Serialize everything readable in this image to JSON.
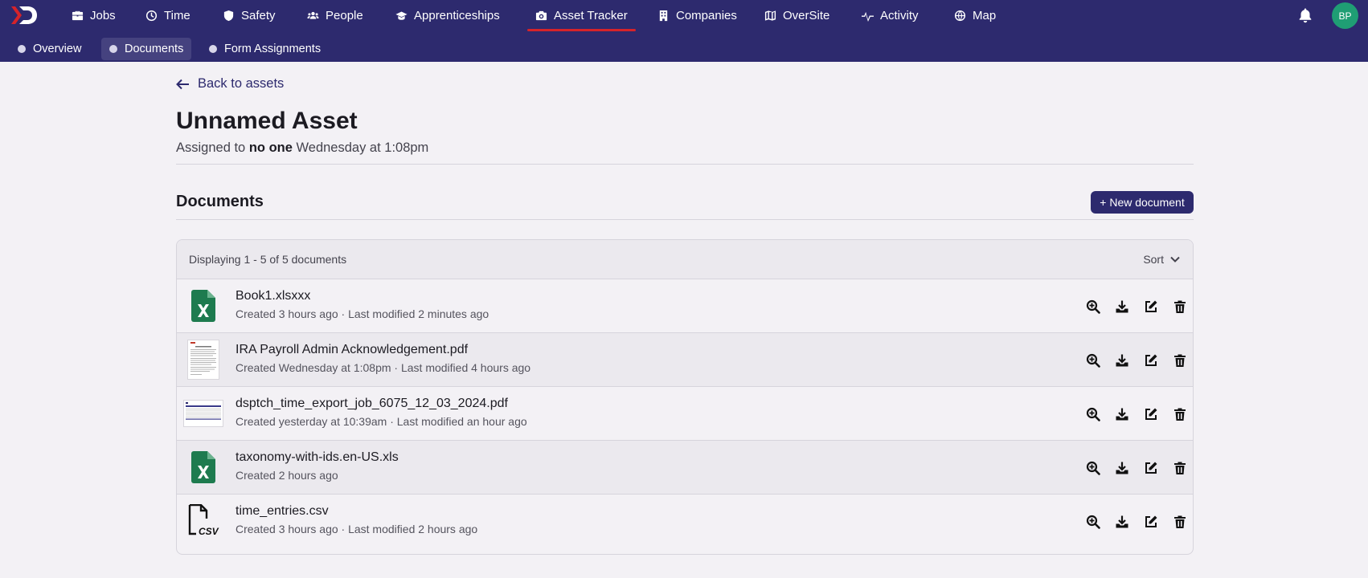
{
  "nav": {
    "items": [
      {
        "label": "Jobs",
        "icon": "briefcase-icon"
      },
      {
        "label": "Time",
        "icon": "clock-icon"
      },
      {
        "label": "Safety",
        "icon": "shield-icon"
      },
      {
        "label": "People",
        "icon": "people-icon"
      },
      {
        "label": "Apprenticeships",
        "icon": "graduation-cap-icon"
      },
      {
        "label": "Asset Tracker",
        "icon": "camera-icon",
        "active": true
      },
      {
        "label": "Companies",
        "icon": "building-icon"
      },
      {
        "label": "OverSite",
        "icon": "map-fold-icon"
      },
      {
        "label": "Activity",
        "icon": "pulse-icon"
      },
      {
        "label": "Map",
        "icon": "globe-icon"
      }
    ],
    "avatar_initials": "BP",
    "accent": "#d6232a",
    "bar_color": "#2d2a6e"
  },
  "subnav": {
    "items": [
      {
        "label": "Overview"
      },
      {
        "label": "Documents",
        "active": true
      },
      {
        "label": "Form Assignments"
      }
    ]
  },
  "page": {
    "back_label": "Back to assets",
    "title": "Unnamed Asset",
    "assigned_prefix": "Assigned to",
    "assigned_to": "no one",
    "assigned_when": "Wednesday at 1:08pm"
  },
  "documents": {
    "heading": "Documents",
    "new_button": "+ New document",
    "count_text": "Displaying 1 - 5 of 5 documents",
    "sort_label": "Sort",
    "rows": [
      {
        "name": "Book1.xlsxxx",
        "meta": "Created 3 hours ago · Last modified 2 minutes ago",
        "type": "excel"
      },
      {
        "name": "IRA Payroll Admin Acknowledgement.pdf",
        "meta": "Created Wednesday at 1:08pm · Last modified 4 hours ago",
        "type": "pdf-page"
      },
      {
        "name": "dsptch_time_export_job_6075_12_03_2024.pdf",
        "meta": "Created yesterday at 10:39am · Last modified an hour ago",
        "type": "pdf-table"
      },
      {
        "name": "taxonomy-with-ids.en-US.xls",
        "meta": "Created 2 hours ago",
        "type": "excel"
      },
      {
        "name": "time_entries.csv",
        "meta": "Created 3 hours ago · Last modified 2 hours ago",
        "type": "csv"
      }
    ]
  }
}
